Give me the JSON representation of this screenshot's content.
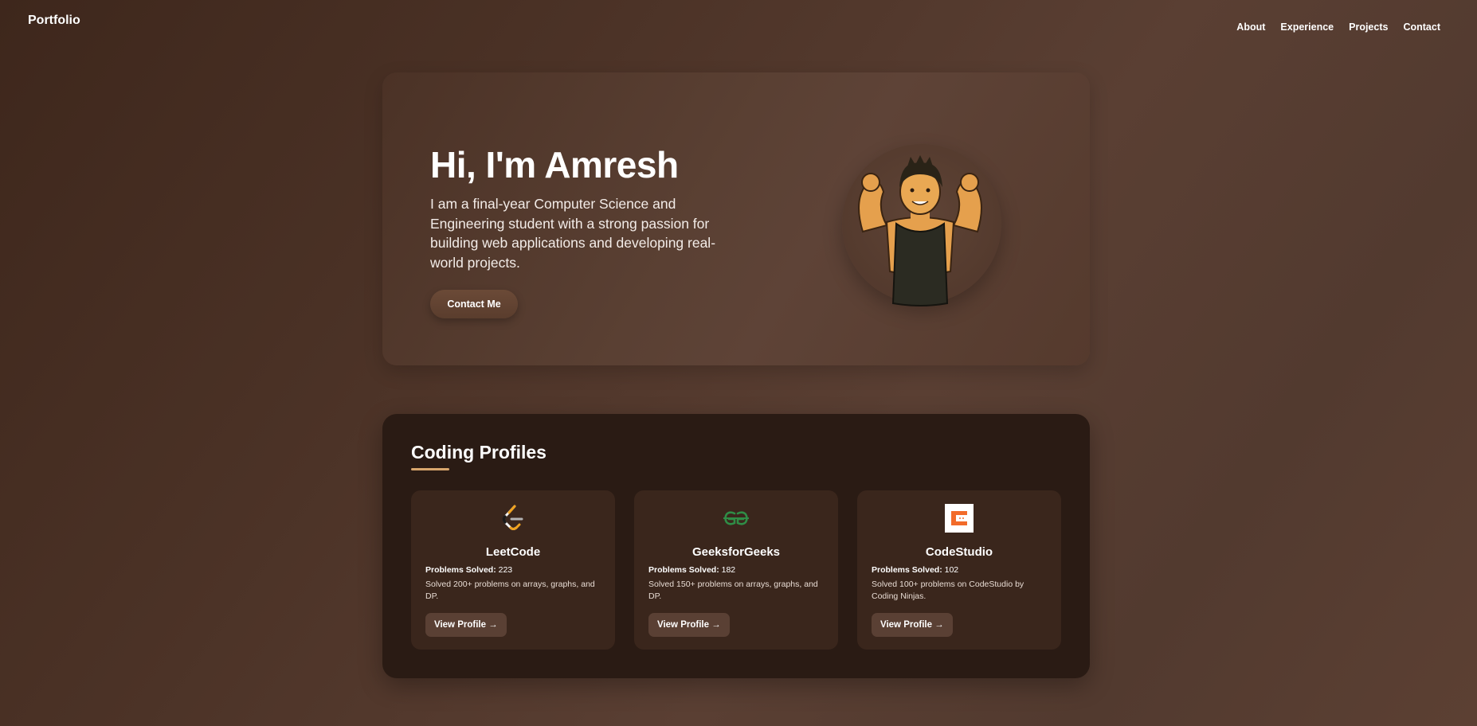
{
  "header": {
    "brand": "Portfolio",
    "nav": [
      "About",
      "Experience",
      "Projects",
      "Contact"
    ]
  },
  "hero": {
    "title": "Hi, I'm Amresh",
    "description": "I am a final-year Computer Science and Engineering student with a strong passion for building web applications and developing real-world projects.",
    "button": "Contact Me"
  },
  "profiles": {
    "title": "Coding Profiles",
    "solved_label": "Problems Solved:",
    "cards": [
      {
        "name": "LeetCode",
        "solved": "223",
        "description": "Solved 200+ problems on arrays, graphs, and DP.",
        "button": "View Profile →",
        "icon": "leetcode-icon"
      },
      {
        "name": "GeeksforGeeks",
        "solved": "182",
        "description": "Solved 150+ problems on arrays, graphs, and DP.",
        "button": "View Profile →",
        "icon": "geeksforgeeks-icon"
      },
      {
        "name": "CodeStudio",
        "solved": "102",
        "description": "Solved 100+ problems on CodeStudio by Coding Ninjas.",
        "button": "View Profile →",
        "icon": "codestudio-icon"
      }
    ]
  },
  "colors": {
    "accent_underline": "#d7a56c",
    "card_bg": "#3a261c",
    "section_bg": "#2a1b14",
    "gfg_green": "#2f8d46",
    "codestudio_orange": "#f26b2a"
  }
}
